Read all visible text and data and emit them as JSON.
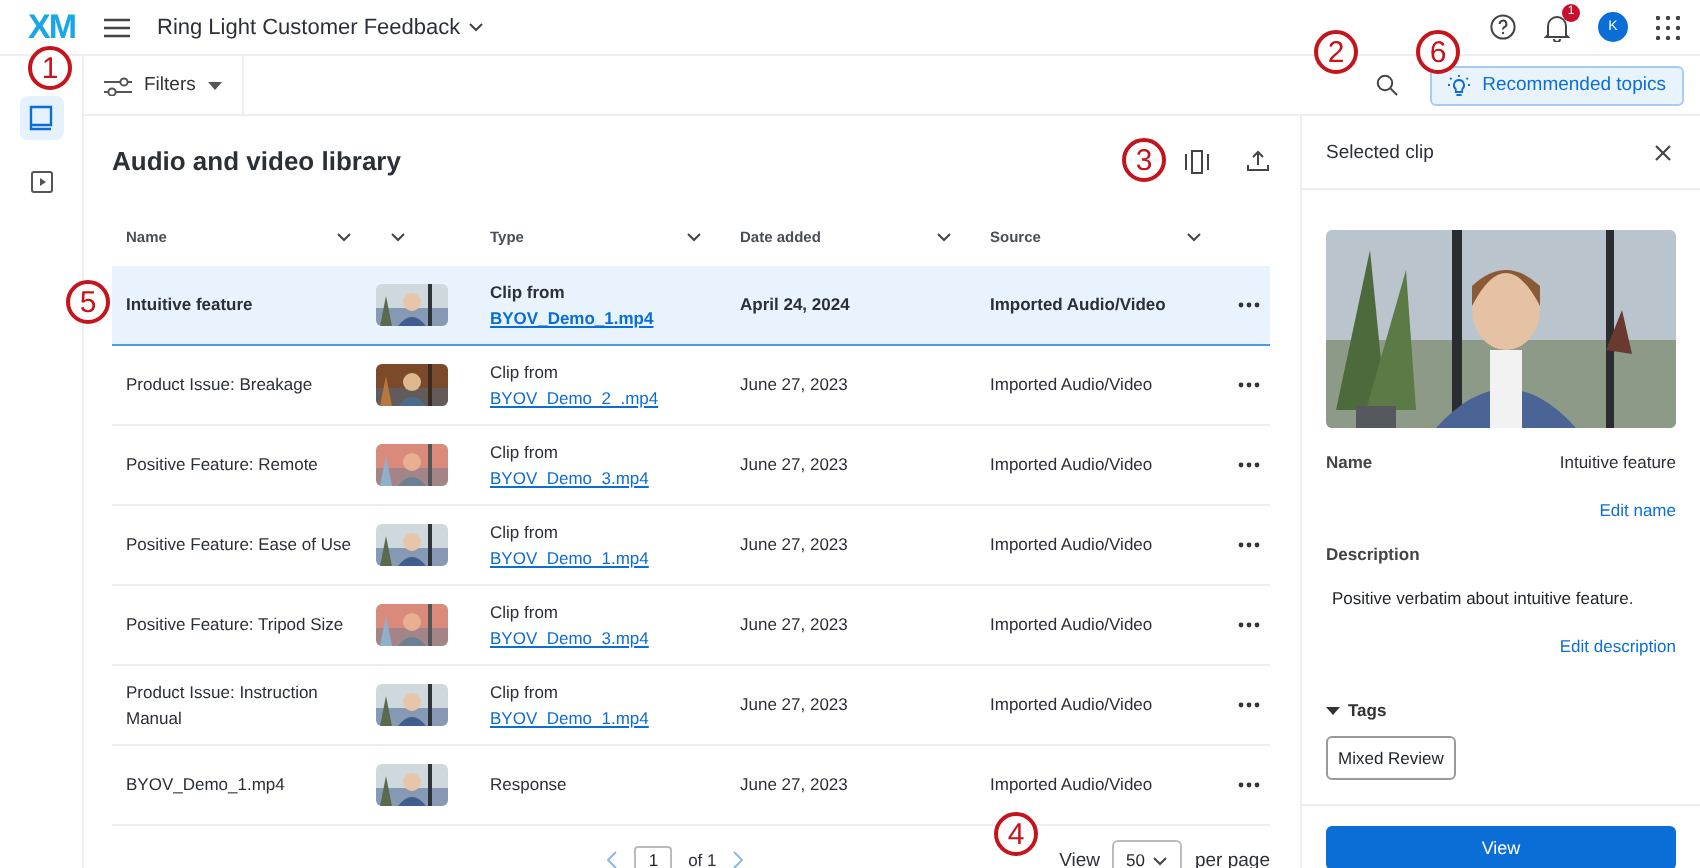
{
  "top_bar": {
    "logo": "XM",
    "project_title": "Ring Light Customer Feedback",
    "notification_count": "1",
    "avatar_initial": "K"
  },
  "rail_items": [
    {
      "selected": true
    },
    {
      "selected": false
    }
  ],
  "toolbar": {
    "filters_label": "Filters",
    "recommended_button": "Recommended topics"
  },
  "library": {
    "title": "Audio and video library",
    "columns": [
      "Name",
      "Type",
      "Date added",
      "Source"
    ],
    "rows": [
      {
        "name": "Intuitive feature",
        "selected": true,
        "type": "Clip from",
        "file": "BYOV_Demo_1.mp4",
        "date": "April 24, 2024",
        "source": "Imported Audio/Video"
      },
      {
        "name": "Product Issue: Breakage",
        "selected": false,
        "type": "Clip from",
        "file": "BYOV_Demo_2_.mp4",
        "date": "June 27, 2023",
        "source": "Imported Audio/Video"
      },
      {
        "name": "Positive Feature: Remote",
        "selected": false,
        "type": "Clip from",
        "file": "BYOV_Demo_3.mp4",
        "date": "June 27, 2023",
        "source": "Imported Audio/Video"
      },
      {
        "name": "Positive Feature: Ease of Use",
        "selected": false,
        "type": "Clip from",
        "file": "BYOV_Demo_1.mp4",
        "date": "June 27, 2023",
        "source": "Imported Audio/Video"
      },
      {
        "name": "Positive Feature: Tripod Size",
        "selected": false,
        "type": "Clip from",
        "file": "BYOV_Demo_3.mp4",
        "date": "June 27, 2023",
        "source": "Imported Audio/Video"
      },
      {
        "name": "Product Issue: Instruction Manual",
        "selected": false,
        "type": "Clip from",
        "file": "BYOV_Demo_1.mp4",
        "date": "June 27, 2023",
        "source": "Imported Audio/Video"
      },
      {
        "name": "BYOV_Demo_1.mp4",
        "selected": false,
        "type": "Response",
        "date": "June 27, 2023",
        "source": "Imported Audio/Video"
      }
    ],
    "pagination": {
      "page": "1",
      "of": "of 1",
      "view": "View",
      "per_page_value": "50",
      "per_page": "per page"
    }
  },
  "panel": {
    "title": "Selected clip",
    "name_label": "Name",
    "name_value": "Intuitive feature",
    "edit_name": "Edit name",
    "description_label": "Description",
    "description": "Positive verbatim about intuitive feature.",
    "edit_description": "Edit description",
    "tags_label": "Tags",
    "tags_expanded": true,
    "tags": [
      "Mixed Review"
    ],
    "view_button": "View"
  },
  "callouts": [
    "1",
    "2",
    "3",
    "4",
    "5",
    "6"
  ]
}
